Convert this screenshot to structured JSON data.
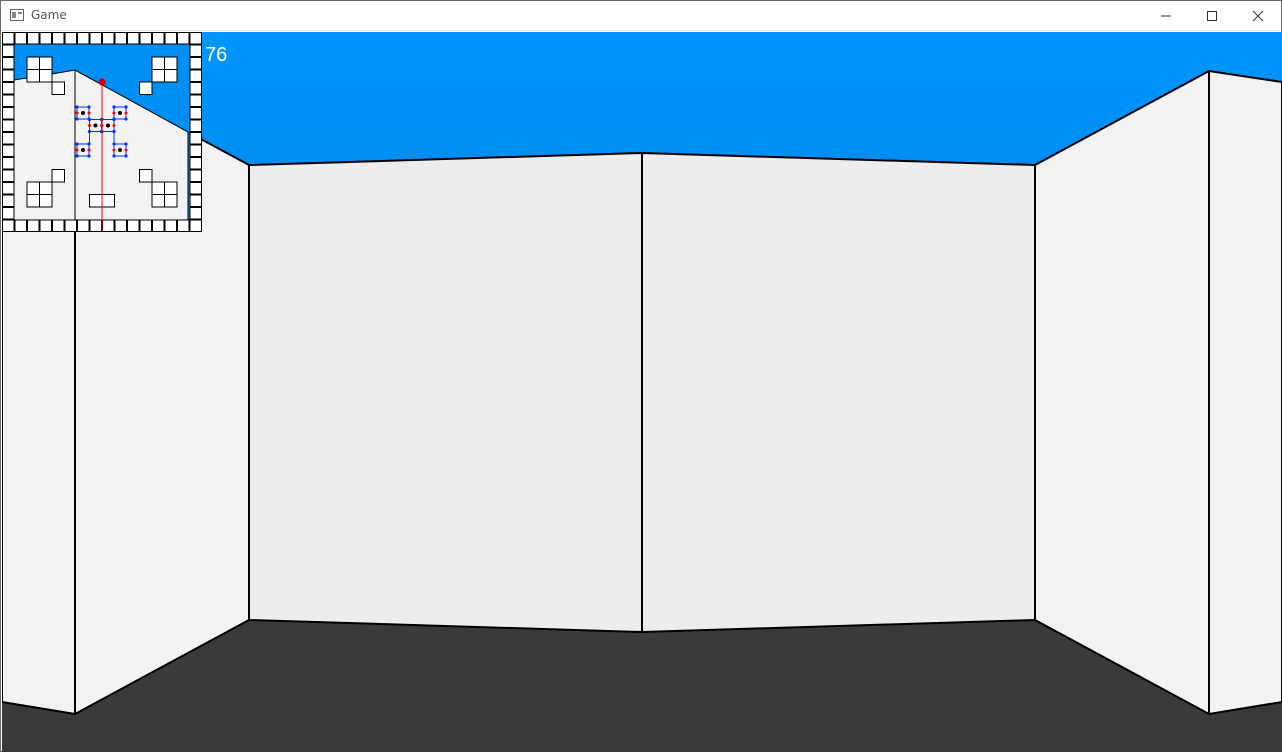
{
  "window": {
    "title": "Game",
    "icons": {
      "app": "app-window-icon",
      "minimize": "minimize-icon",
      "maximize": "maximize-icon",
      "close": "close-icon"
    }
  },
  "hud": {
    "fps": "76"
  },
  "colors": {
    "sky_top": "#0096FF",
    "sky_bottom": "#0082E0",
    "floor": "#3A3A3A",
    "wall": "#F2F2F2",
    "wall_front": "#EDEDED",
    "wall_edge": "#000000",
    "ray": "#FF0000",
    "player": "#CC0000",
    "node_blue": "#0033FF",
    "node_red": "#FF0000"
  }
}
